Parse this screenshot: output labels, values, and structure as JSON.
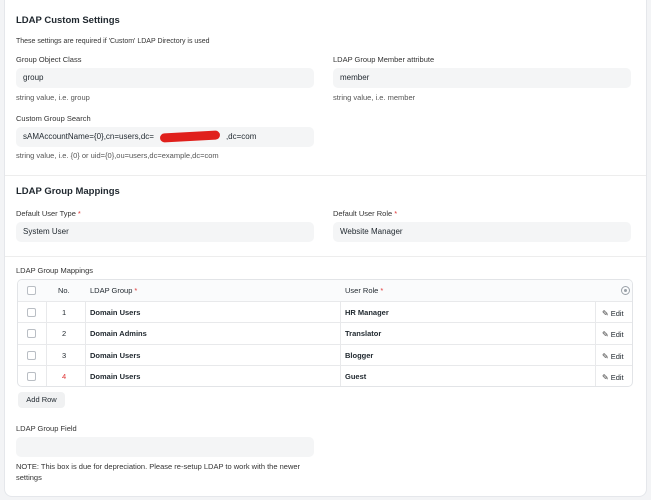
{
  "custom_settings": {
    "title": "LDAP Custom Settings",
    "description": "These settings are required if 'Custom' LDAP Directory is used",
    "group_object_class": {
      "label": "Group Object Class",
      "value": "group",
      "help": "string value, i.e. group"
    },
    "group_member_attribute": {
      "label": "LDAP Group Member attribute",
      "value": "member",
      "help": "string value, i.e. member"
    },
    "custom_group_search": {
      "label": "Custom Group Search",
      "value": "sAMAccountName={0},cn=users,dc=         ,dc=com",
      "help": "string value, i.e. {0} or uid={0},ou=users,dc=example,dc=com"
    }
  },
  "group_mappings_section": {
    "title": "LDAP Group Mappings",
    "default_user_type": {
      "label": "Default User Type",
      "value": "System User"
    },
    "default_user_role": {
      "label": "Default User Role",
      "value": "Website Manager"
    }
  },
  "mappings_table": {
    "label": "LDAP Group Mappings",
    "columns": {
      "no": "No.",
      "ldap_group": "LDAP Group",
      "user_role": "User Role"
    },
    "rows": [
      {
        "no": "1",
        "ldap_group": "Domain Users",
        "user_role": "HR Manager",
        "edit": "Edit"
      },
      {
        "no": "2",
        "ldap_group": "Domain Admins",
        "user_role": "Translator",
        "edit": "Edit"
      },
      {
        "no": "3",
        "ldap_group": "Domain Users",
        "user_role": "Blogger",
        "edit": "Edit"
      },
      {
        "no": "4",
        "ldap_group": "Domain Users",
        "user_role": "Guest",
        "edit": "Edit"
      }
    ],
    "add_row": "Add Row"
  },
  "group_field": {
    "label": "LDAP Group Field",
    "value": "",
    "note_line1": "NOTE: This box is due for depreciation. Please re-setup LDAP to work with the newer",
    "note_line2": "settings"
  },
  "colors": {
    "required": "#e03636",
    "redaction": "#e0201c",
    "field_bg": "#f4f5f6"
  }
}
